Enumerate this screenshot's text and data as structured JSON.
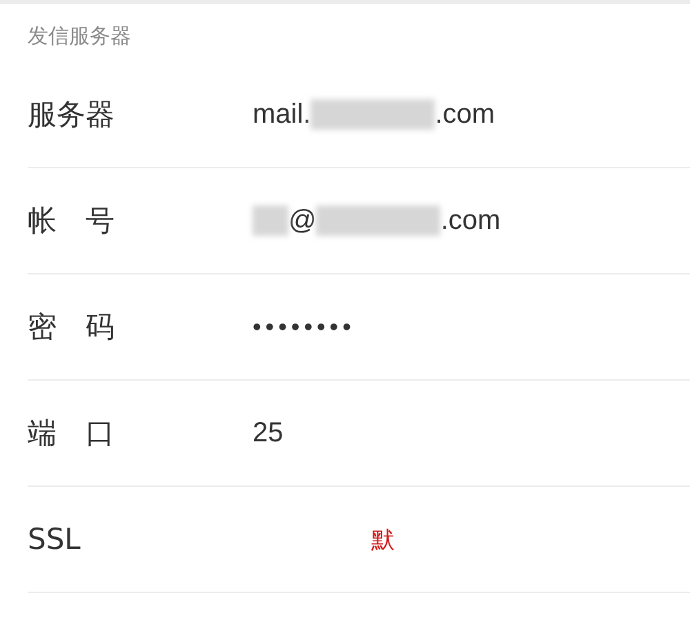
{
  "section": {
    "title": "发信服务器"
  },
  "rows": [
    {
      "label": "服务器",
      "kind": "text",
      "parts": [
        {
          "kind": "text",
          "text": "mail."
        },
        {
          "kind": "redacted"
        },
        {
          "kind": "text",
          "text": ".com"
        }
      ]
    },
    {
      "label": "帐　号",
      "kind": "text",
      "parts": [
        {
          "kind": "redacted"
        },
        {
          "kind": "text",
          "text": "@"
        },
        {
          "kind": "redacted"
        },
        {
          "kind": "text",
          "text": ".com"
        }
      ]
    },
    {
      "label": "密　码",
      "kind": "password",
      "parts": [
        {
          "kind": "text",
          "text": "••••••••"
        }
      ]
    },
    {
      "label": "端　口",
      "kind": "text",
      "parts": [
        {
          "kind": "text",
          "text": "25"
        }
      ]
    },
    {
      "label": "SSL",
      "kind": "option",
      "parts": [
        {
          "kind": "text",
          "text": "默"
        }
      ]
    }
  ]
}
